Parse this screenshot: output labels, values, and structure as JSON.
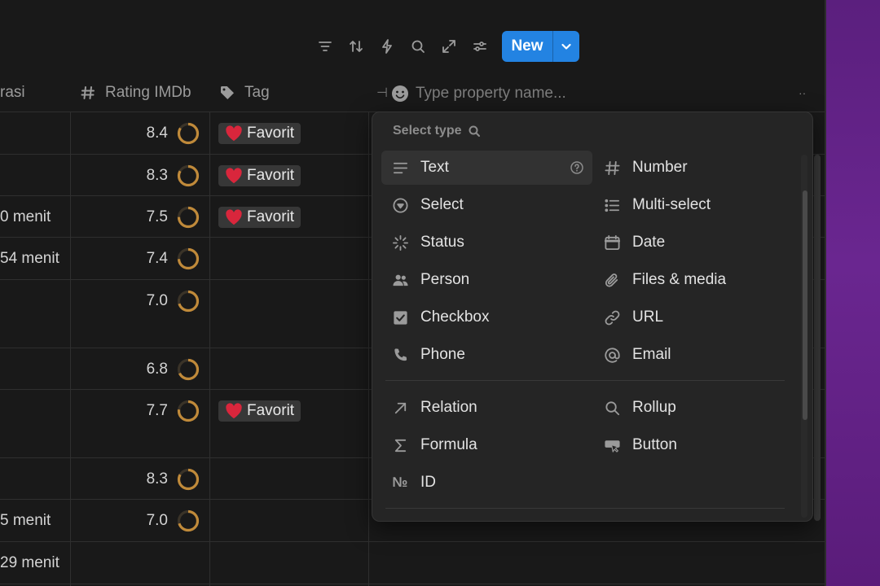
{
  "toolbar": {
    "icons": [
      "filter-icon",
      "sort-icon",
      "automation-icon",
      "search-icon",
      "expand-icon",
      "settings-icon"
    ],
    "new_label": "New",
    "accent": "#2383e2"
  },
  "columns": {
    "duration_partial": "rasi",
    "rating": "Rating IMDb",
    "tag": "Tag"
  },
  "property_input": {
    "placeholder": "Type property name..."
  },
  "rows": [
    {
      "duration": "",
      "rating": "8.4",
      "tag": "Favorit"
    },
    {
      "duration": "",
      "rating": "8.3",
      "tag": "Favorit"
    },
    {
      "duration": "0 menit",
      "rating": "7.5",
      "tag": "Favorit"
    },
    {
      "duration": "54 menit",
      "rating": "7.4",
      "tag": ""
    },
    {
      "duration": "",
      "rating": "7.0",
      "tag": ""
    },
    {
      "duration": "",
      "rating": "6.8",
      "tag": ""
    },
    {
      "duration": "",
      "rating": "7.7",
      "tag": "Favorit"
    },
    {
      "duration": "",
      "rating": "8.3",
      "tag": ""
    },
    {
      "duration": "5 menit",
      "rating": "7.0",
      "tag": ""
    },
    {
      "duration": "29 menit",
      "rating": "",
      "tag": ""
    }
  ],
  "ring_color": "#c08a3a",
  "menu": {
    "heading": "Select type",
    "basic": [
      {
        "label": "Text",
        "icon": "text-lines-icon",
        "selected": true
      },
      {
        "label": "Number",
        "icon": "hash-icon"
      },
      {
        "label": "Select",
        "icon": "select-circle-icon"
      },
      {
        "label": "Multi-select",
        "icon": "list-icon"
      },
      {
        "label": "Status",
        "icon": "status-loader-icon"
      },
      {
        "label": "Date",
        "icon": "calendar-icon"
      },
      {
        "label": "Person",
        "icon": "people-icon"
      },
      {
        "label": "Files & media",
        "icon": "paperclip-icon"
      },
      {
        "label": "Checkbox",
        "icon": "checkbox-icon"
      },
      {
        "label": "URL",
        "icon": "link-icon"
      },
      {
        "label": "Phone",
        "icon": "phone-icon"
      },
      {
        "label": "Email",
        "icon": "at-icon"
      }
    ],
    "advanced": [
      {
        "label": "Relation",
        "icon": "arrow-up-right-icon"
      },
      {
        "label": "Rollup",
        "icon": "magnifier-icon"
      },
      {
        "label": "Formula",
        "icon": "sigma-icon"
      },
      {
        "label": "Button",
        "icon": "cursor-button-icon"
      },
      {
        "label": "ID",
        "icon": "numero-icon"
      }
    ]
  }
}
